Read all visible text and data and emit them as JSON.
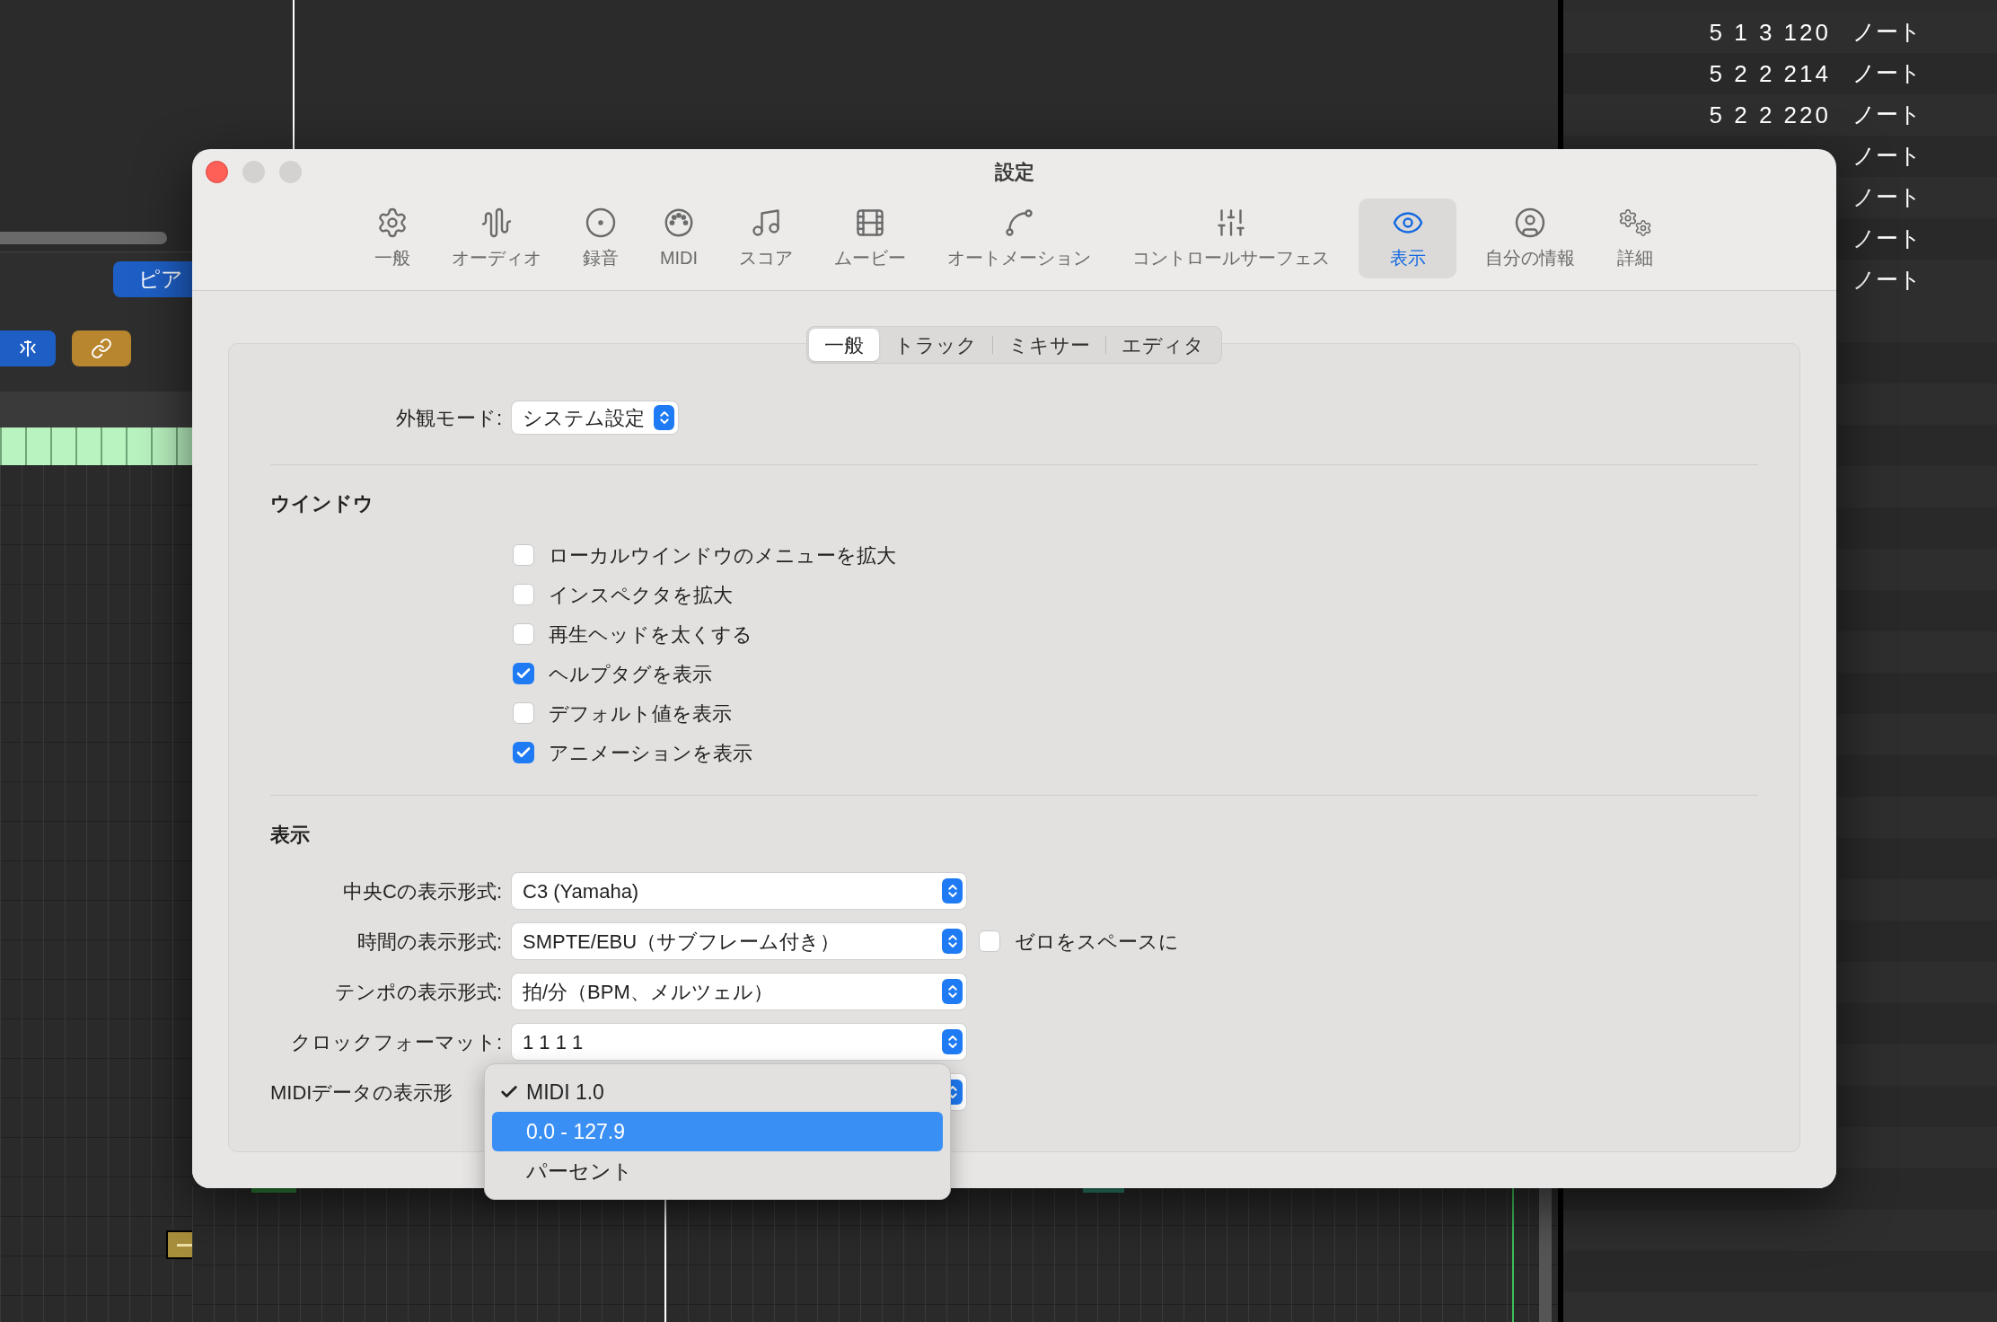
{
  "background": {
    "region_button": "ピア",
    "event_list": [
      {
        "position": "5 1 3 120",
        "type": "ノート"
      },
      {
        "position": "5 2 2 214",
        "type": "ノート"
      },
      {
        "position": "5 2 2 220",
        "type": "ノート"
      },
      {
        "type": "ノート"
      },
      {
        "type": "ノート"
      },
      {
        "type": "ノート"
      },
      {
        "type": "ノート"
      }
    ]
  },
  "dialog": {
    "title": "設定",
    "toolbar": [
      {
        "label": "一般",
        "selected": false
      },
      {
        "label": "オーディオ",
        "selected": false
      },
      {
        "label": "録音",
        "selected": false
      },
      {
        "label": "MIDI",
        "selected": false
      },
      {
        "label": "スコア",
        "selected": false
      },
      {
        "label": "ムービー",
        "selected": false
      },
      {
        "label": "オートメーション",
        "selected": false
      },
      {
        "label": "コントロールサーフェス",
        "selected": false
      },
      {
        "label": "表示",
        "selected": true
      },
      {
        "label": "自分の情報",
        "selected": false
      },
      {
        "label": "詳細",
        "selected": false
      }
    ],
    "tabs": [
      {
        "label": "一般",
        "selected": true
      },
      {
        "label": "トラック",
        "selected": false
      },
      {
        "label": "ミキサー",
        "selected": false
      },
      {
        "label": "エディタ",
        "selected": false
      }
    ],
    "appearance": {
      "label": "外観モード:",
      "value": "システム設定"
    },
    "window_section": {
      "heading": "ウインドウ",
      "options": [
        {
          "label": "ローカルウインドウのメニューを拡大",
          "checked": false
        },
        {
          "label": "インスペクタを拡大",
          "checked": false
        },
        {
          "label": "再生ヘッドを太くする",
          "checked": false
        },
        {
          "label": "ヘルプタグを表示",
          "checked": true
        },
        {
          "label": "デフォルト値を表示",
          "checked": false
        },
        {
          "label": "アニメーションを表示",
          "checked": true
        }
      ]
    },
    "display_section": {
      "heading": "表示",
      "rows": [
        {
          "label": "中央Cの表示形式:",
          "value": "C3 (Yamaha)"
        },
        {
          "label": "時間の表示形式:",
          "value": "SMPTE/EBU（サブフレーム付き）",
          "checkbox": {
            "label": "ゼロをスペースに",
            "checked": false
          }
        },
        {
          "label": "テンポの表示形式:",
          "value": "拍/分（BPM、メルツェル）"
        },
        {
          "label": "クロックフォーマット:",
          "value": "1 1 1 1"
        },
        {
          "label": "MIDIデータの表示形",
          "menu": [
            {
              "label": "MIDI 1.0",
              "checked": true,
              "selected": false
            },
            {
              "label": "0.0 - 127.9",
              "checked": false,
              "selected": true
            },
            {
              "label": "パーセント",
              "checked": false,
              "selected": false
            }
          ]
        }
      ]
    }
  }
}
